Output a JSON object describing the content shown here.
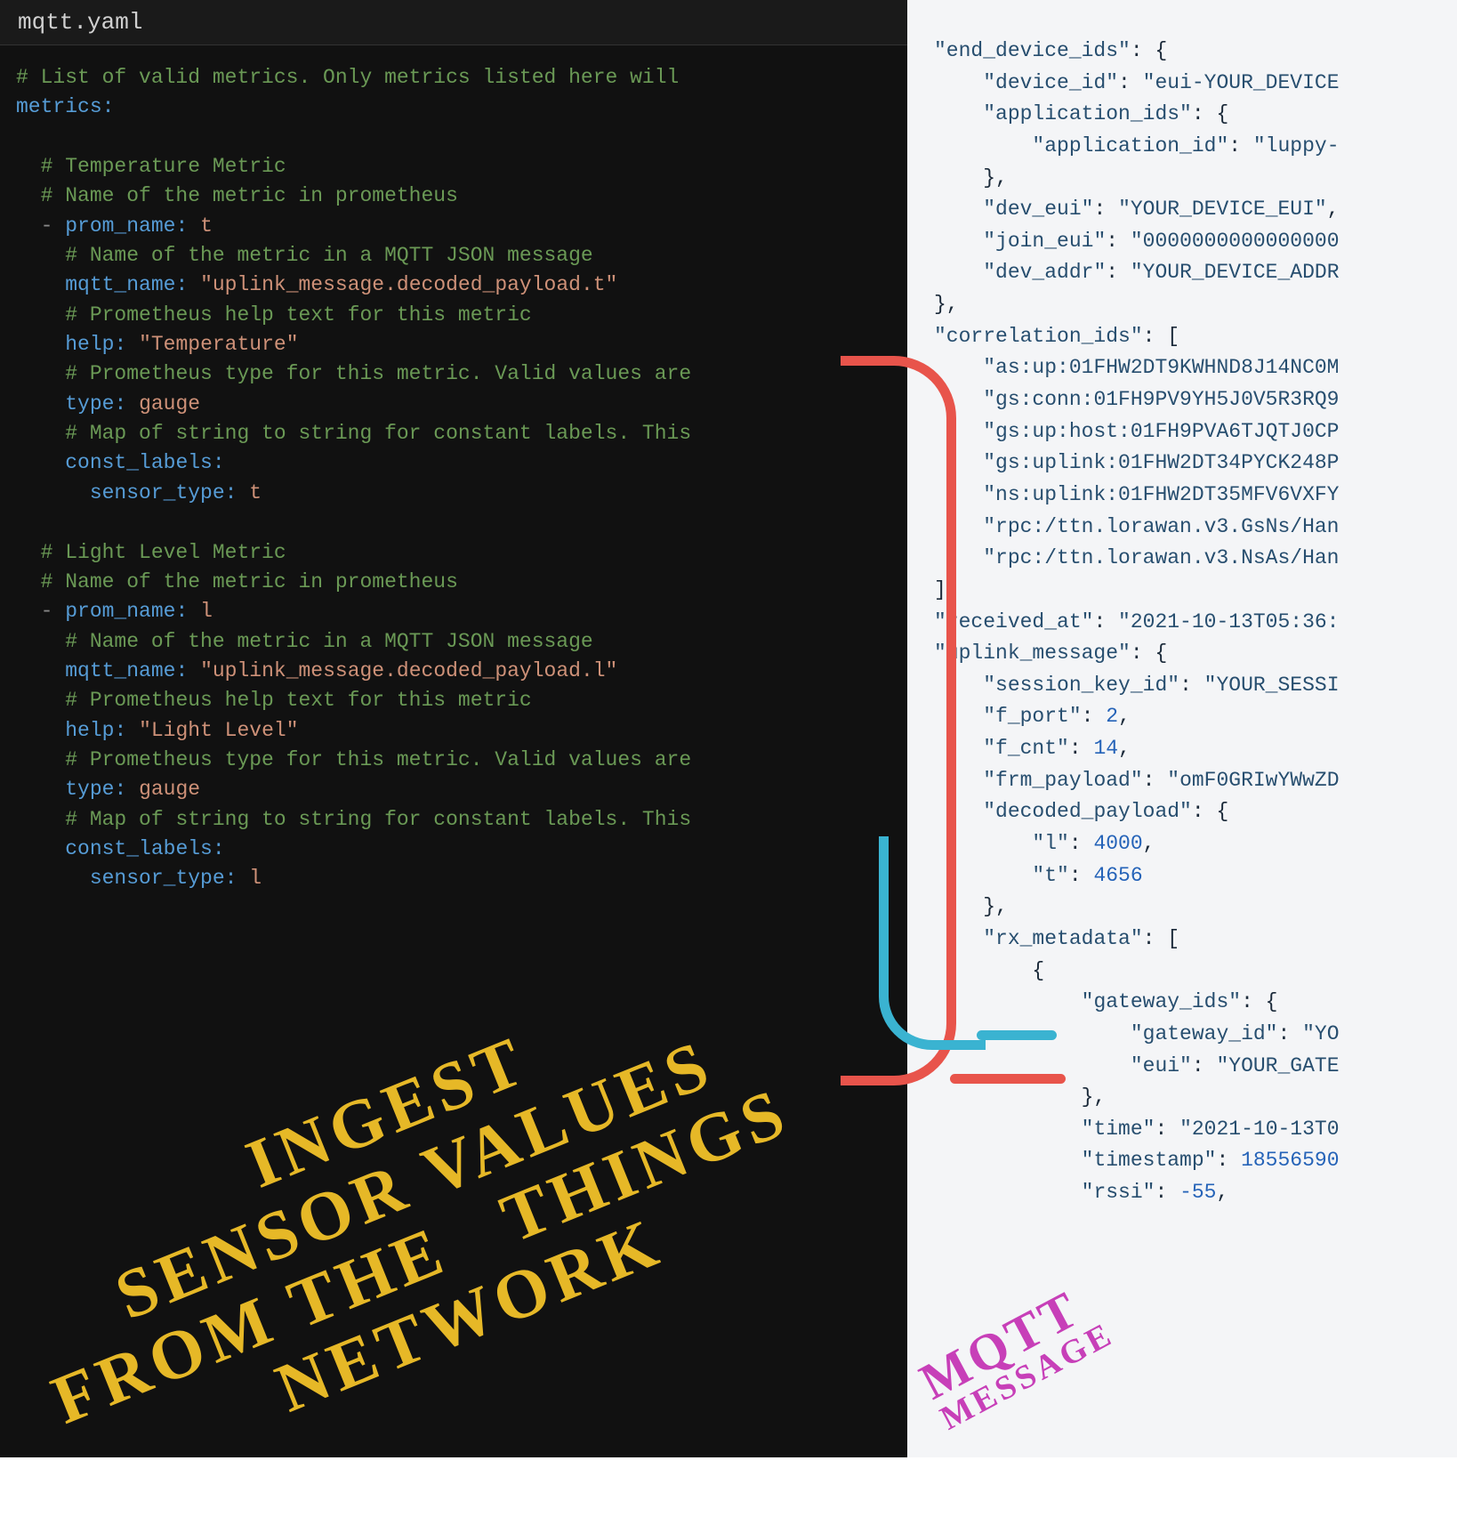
{
  "tab": {
    "filename": "mqtt.yaml"
  },
  "yaml": {
    "top_comment": "# List of valid metrics. Only metrics listed here will",
    "metrics_key": "metrics",
    "metric1": {
      "c1": "# Temperature Metric",
      "c2": "# Name of the metric in prometheus",
      "prom_name_key": "prom_name",
      "prom_name_val": "t",
      "c3": "# Name of the metric in a MQTT JSON message",
      "mqtt_name_key": "mqtt_name",
      "mqtt_name_val": "\"uplink_message.decoded_payload.t\"",
      "c4": "# Prometheus help text for this metric",
      "help_key": "help",
      "help_val": "\"Temperature\"",
      "c5": "# Prometheus type for this metric. Valid values are",
      "type_key": "type",
      "type_val": "gauge",
      "c6": "# Map of string to string for constant labels. This",
      "const_labels_key": "const_labels",
      "sensor_type_key": "sensor_type",
      "sensor_type_val": "t"
    },
    "metric2": {
      "c1": "# Light Level Metric",
      "c2": "# Name of the metric in prometheus",
      "prom_name_key": "prom_name",
      "prom_name_val": "l",
      "c3": "# Name of the metric in a MQTT JSON message",
      "mqtt_name_key": "mqtt_name",
      "mqtt_name_val": "\"uplink_message.decoded_payload.l\"",
      "c4": "# Prometheus help text for this metric",
      "help_key": "help",
      "help_val": "\"Light Level\"",
      "c5": "# Prometheus type for this metric. Valid values are",
      "type_key": "type",
      "type_val": "gauge",
      "c6": "# Map of string to string for constant labels. This",
      "const_labels_key": "const_labels",
      "sensor_type_key": "sensor_type",
      "sensor_type_val": "l"
    }
  },
  "json_msg": {
    "end_device_ids_key": "\"end_device_ids\"",
    "device_id_key": "\"device_id\"",
    "device_id_val": "\"eui-YOUR_DEVICE",
    "application_ids_key": "\"application_ids\"",
    "application_id_key": "\"application_id\"",
    "application_id_val": "\"luppy-",
    "dev_eui_key": "\"dev_eui\"",
    "dev_eui_val": "\"YOUR_DEVICE_EUI\"",
    "join_eui_key": "\"join_eui\"",
    "join_eui_val": "\"0000000000000000",
    "dev_addr_key": "\"dev_addr\"",
    "dev_addr_val": "\"YOUR_DEVICE_ADDR",
    "correlation_ids_key": "\"correlation_ids\"",
    "corr1": "\"as:up:01FHW2DT9KWHND8J14NC0M",
    "corr2": "\"gs:conn:01FH9PV9YH5J0V5R3RQ9",
    "corr3": "\"gs:up:host:01FH9PVA6TJQTJ0CP",
    "corr4": "\"gs:uplink:01FHW2DT34PYCK248P",
    "corr5": "\"ns:uplink:01FHW2DT35MFV6VXFY",
    "corr6": "\"rpc:/ttn.lorawan.v3.GsNs/Han",
    "corr7": "\"rpc:/ttn.lorawan.v3.NsAs/Han",
    "received_at_key": "\"received_at\"",
    "received_at_val": "\"2021-10-13T05:36:",
    "uplink_message_key": "\"uplink_message\"",
    "session_key_id_key": "\"session_key_id\"",
    "session_key_id_val": "\"YOUR_SESSI",
    "f_port_key": "\"f_port\"",
    "f_port_val": "2",
    "f_cnt_key": "\"f_cnt\"",
    "f_cnt_val": "14",
    "frm_payload_key": "\"frm_payload\"",
    "frm_payload_val": "\"omF0GRIwYWwZD",
    "decoded_payload_key": "\"decoded_payload\"",
    "l_key": "\"l\"",
    "l_val": "4000",
    "t_key": "\"t\"",
    "t_val": "4656",
    "rx_metadata_key": "\"rx_metadata\"",
    "gateway_ids_key": "\"gateway_ids\"",
    "gateway_id_key": "\"gateway_id\"",
    "gateway_id_val": "\"YO",
    "eui_key": "\"eui\"",
    "eui_val": "\"YOUR_GATE",
    "time_key": "\"time\"",
    "time_val": "\"2021-10-13T0",
    "timestamp_key": "\"timestamp\"",
    "timestamp_val": "18556590",
    "rssi_key": "\"rssi\"",
    "rssi_val": "-55"
  },
  "annot": {
    "yellow_l1": "INGEST",
    "yellow_l2": "SENSOR VALUES",
    "yellow_l3": "FROM THE",
    "yellow_l4": "THINGS",
    "yellow_l5": "NETWORK",
    "magenta_l1": "MQTT",
    "magenta_l2": "MESSAGE"
  }
}
